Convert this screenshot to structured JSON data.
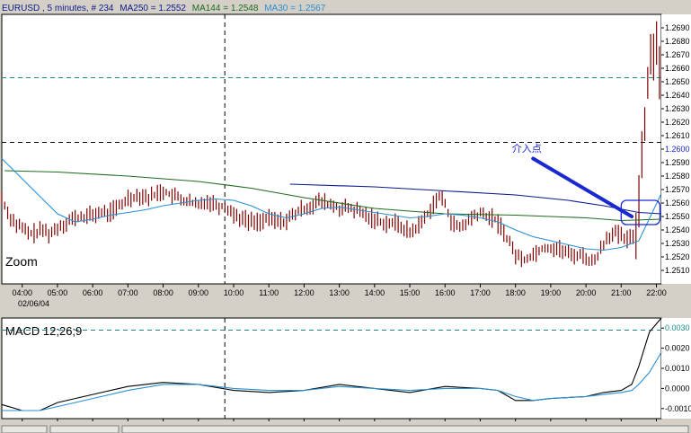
{
  "header": {
    "symbol_text": "EURUSD , 5 minutes, # 234",
    "ma250_text": "MA250 = 1.2552",
    "ma144_text": "MA144 = 1.2548",
    "ma30_text": "MA30 = 1.2567"
  },
  "colors": {
    "background": "#ffffff",
    "frame": "#d4d0c8",
    "price_bar": "#800000",
    "ma250": "#0b1a8a",
    "ma144": "#1e6b1e",
    "ma30": "#2a90d0",
    "macd_line": "#000000",
    "macd_signal": "#2a90d0",
    "arrow": "#1a28d0",
    "highlight_box": "#1a28d0",
    "hline_cyan": "#1a8a8a",
    "hline_dark": "#000000"
  },
  "main_panel": {
    "zoom_label": "Zoom",
    "annotation_text": "介入点",
    "date_label": "02/06/04"
  },
  "macd_panel": {
    "label": "MACD 12;26;9"
  },
  "chart_data": [
    {
      "type": "candlestick",
      "title": "EURUSD , 5 minutes, # 234",
      "x_ticks": [
        "04:00",
        "05:00",
        "06:00",
        "07:00",
        "08:00",
        "09:00",
        "10:00",
        "11:00",
        "12:00",
        "13:00",
        "14:00",
        "15:00",
        "16:00",
        "17:00",
        "18:00",
        "19:00",
        "20:00",
        "21:00",
        "22:00"
      ],
      "x_range": [
        3.42,
        22.14
      ],
      "y_range": [
        1.25,
        1.27
      ],
      "y_ticks": [
        "1.2510",
        "1.2520",
        "1.2530",
        "1.2540",
        "1.2550",
        "1.2560",
        "1.2570",
        "1.2580",
        "1.2590",
        "1.2600",
        "1.2610",
        "1.2620",
        "1.2630",
        "1.2640",
        "1.2650",
        "1.2660",
        "1.2670",
        "1.2680",
        "1.2690"
      ],
      "highlighted_ticks": [
        "1.2600",
        "1.2653"
      ],
      "horizontal_lines": [
        {
          "y": 1.2653,
          "style": "dashed",
          "color": "cyan"
        },
        {
          "y": 1.2605,
          "style": "dashed",
          "color": "black"
        }
      ],
      "vertical_line_x": 9.75,
      "price_path": [
        [
          3.42,
          1.2564
        ],
        [
          3.6,
          1.2552
        ],
        [
          3.8,
          1.2545
        ],
        [
          4.0,
          1.2541
        ],
        [
          4.2,
          1.2537
        ],
        [
          4.4,
          1.2538
        ],
        [
          4.6,
          1.254
        ],
        [
          4.8,
          1.2537
        ],
        [
          5.0,
          1.2542
        ],
        [
          5.2,
          1.2545
        ],
        [
          5.4,
          1.2548
        ],
        [
          5.6,
          1.2549
        ],
        [
          5.8,
          1.255
        ],
        [
          6.0,
          1.2551
        ],
        [
          6.2,
          1.2553
        ],
        [
          6.4,
          1.2552
        ],
        [
          6.6,
          1.2555
        ],
        [
          6.8,
          1.2558
        ],
        [
          7.0,
          1.2564
        ],
        [
          7.2,
          1.2565
        ],
        [
          7.4,
          1.2566
        ],
        [
          7.6,
          1.2564
        ],
        [
          7.8,
          1.2567
        ],
        [
          8.0,
          1.2569
        ],
        [
          8.2,
          1.2566
        ],
        [
          8.4,
          1.2564
        ],
        [
          8.6,
          1.2562
        ],
        [
          8.8,
          1.256
        ],
        [
          9.0,
          1.2558
        ],
        [
          9.2,
          1.2562
        ],
        [
          9.4,
          1.256
        ],
        [
          9.6,
          1.2558
        ],
        [
          9.8,
          1.2557
        ],
        [
          10.0,
          1.2552
        ],
        [
          10.2,
          1.2549
        ],
        [
          10.4,
          1.2547
        ],
        [
          10.6,
          1.2546
        ],
        [
          10.8,
          1.2547
        ],
        [
          11.0,
          1.2548
        ],
        [
          11.2,
          1.2547
        ],
        [
          11.4,
          1.2546
        ],
        [
          11.6,
          1.2549
        ],
        [
          11.8,
          1.2553
        ],
        [
          12.0,
          1.2556
        ],
        [
          12.2,
          1.2558
        ],
        [
          12.4,
          1.2561
        ],
        [
          12.6,
          1.256
        ],
        [
          12.8,
          1.2558
        ],
        [
          13.0,
          1.2556
        ],
        [
          13.2,
          1.2556
        ],
        [
          13.4,
          1.2555
        ],
        [
          13.6,
          1.2553
        ],
        [
          13.8,
          1.255
        ],
        [
          14.0,
          1.2548
        ],
        [
          14.2,
          1.2546
        ],
        [
          14.4,
          1.2545
        ],
        [
          14.6,
          1.2545
        ],
        [
          14.8,
          1.2542
        ],
        [
          15.0,
          1.2538
        ],
        [
          15.2,
          1.2542
        ],
        [
          15.4,
          1.2548
        ],
        [
          15.6,
          1.2556
        ],
        [
          15.8,
          1.2565
        ],
        [
          16.0,
          1.256
        ],
        [
          16.2,
          1.2545
        ],
        [
          16.4,
          1.2541
        ],
        [
          16.6,
          1.2545
        ],
        [
          16.8,
          1.255
        ],
        [
          17.0,
          1.2552
        ],
        [
          17.2,
          1.255
        ],
        [
          17.4,
          1.2548
        ],
        [
          17.6,
          1.2542
        ],
        [
          17.8,
          1.2532
        ],
        [
          18.0,
          1.2522
        ],
        [
          18.2,
          1.2518
        ],
        [
          18.4,
          1.252
        ],
        [
          18.6,
          1.2524
        ],
        [
          18.8,
          1.2527
        ],
        [
          19.0,
          1.2527
        ],
        [
          19.2,
          1.2526
        ],
        [
          19.4,
          1.2524
        ],
        [
          19.6,
          1.2521
        ],
        [
          19.8,
          1.2522
        ],
        [
          20.0,
          1.252
        ],
        [
          20.2,
          1.2515
        ],
        [
          20.4,
          1.2525
        ],
        [
          20.6,
          1.2535
        ],
        [
          20.8,
          1.2538
        ],
        [
          21.0,
          1.2535
        ],
        [
          21.2,
          1.2532
        ],
        [
          21.4,
          1.2538
        ],
        [
          21.5,
          1.256
        ],
        [
          21.6,
          1.2605
        ],
        [
          21.7,
          1.263
        ],
        [
          21.8,
          1.266
        ],
        [
          21.9,
          1.268
        ],
        [
          22.0,
          1.2675
        ],
        [
          22.14,
          1.2658
        ]
      ],
      "series": [
        {
          "name": "MA250",
          "values": [
            [
              11.6,
              1.2574
            ],
            [
              14.0,
              1.2572
            ],
            [
              16.0,
              1.2569
            ],
            [
              18.0,
              1.2566
            ],
            [
              19.5,
              1.2562
            ],
            [
              20.5,
              1.2558
            ],
            [
              21.5,
              1.2553
            ],
            [
              22.14,
              1.2552
            ]
          ]
        },
        {
          "name": "MA144",
          "values": [
            [
              3.5,
              1.2584
            ],
            [
              5.0,
              1.2583
            ],
            [
              7.0,
              1.258
            ],
            [
              9.0,
              1.2576
            ],
            [
              10.5,
              1.2571
            ],
            [
              12.0,
              1.2564
            ],
            [
              14.0,
              1.2556
            ],
            [
              16.0,
              1.2552
            ],
            [
              18.0,
              1.2551
            ],
            [
              20.0,
              1.2549
            ],
            [
              21.0,
              1.2547
            ],
            [
              22.14,
              1.2548
            ]
          ]
        },
        {
          "name": "MA30",
          "values": [
            [
              3.42,
              1.2593
            ],
            [
              4.0,
              1.2578
            ],
            [
              4.5,
              1.2565
            ],
            [
              5.0,
              1.2552
            ],
            [
              5.5,
              1.2546
            ],
            [
              6.0,
              1.2548
            ],
            [
              6.5,
              1.2551
            ],
            [
              7.0,
              1.2553
            ],
            [
              7.5,
              1.2555
            ],
            [
              8.0,
              1.2558
            ],
            [
              8.5,
              1.256
            ],
            [
              9.0,
              1.2562
            ],
            [
              9.5,
              1.2563
            ],
            [
              10.0,
              1.2562
            ],
            [
              10.5,
              1.2558
            ],
            [
              11.0,
              1.2552
            ],
            [
              11.5,
              1.2549
            ],
            [
              12.0,
              1.2552
            ],
            [
              12.5,
              1.2556
            ],
            [
              13.0,
              1.2557
            ],
            [
              13.5,
              1.2555
            ],
            [
              14.0,
              1.2553
            ],
            [
              14.5,
              1.2551
            ],
            [
              15.0,
              1.2549
            ],
            [
              15.5,
              1.255
            ],
            [
              16.0,
              1.2552
            ],
            [
              16.5,
              1.2551
            ],
            [
              17.0,
              1.2549
            ],
            [
              17.5,
              1.2546
            ],
            [
              18.0,
              1.254
            ],
            [
              18.5,
              1.2535
            ],
            [
              19.0,
              1.2532
            ],
            [
              19.5,
              1.2529
            ],
            [
              20.0,
              1.2526
            ],
            [
              20.5,
              1.2525
            ],
            [
              21.0,
              1.2527
            ],
            [
              21.5,
              1.2532
            ],
            [
              22.14,
              1.2567
            ]
          ]
        }
      ],
      "annotation": {
        "label": "介入点",
        "label_at": [
          17.9,
          1.26
        ],
        "arrow_from": [
          18.5,
          1.2593
        ],
        "arrow_to": [
          21.3,
          1.255
        ]
      },
      "highlight_box": {
        "x": [
          21.0,
          22.1
        ],
        "y": [
          1.2544,
          1.2562
        ]
      }
    },
    {
      "type": "line",
      "title": "MACD 12;26;9",
      "x_range": [
        3.42,
        22.14
      ],
      "y_range": [
        -0.0015,
        0.0035
      ],
      "y_ticks": [
        "0.0030",
        "0.0020",
        "0.0010",
        "0.0000",
        "-0.0010"
      ],
      "highlighted_ticks": [
        "0.0030"
      ],
      "horizontal_lines": [
        {
          "y": 0.0029,
          "style": "dashed",
          "color": "cyan"
        }
      ],
      "vertical_line_x": 9.75,
      "series": [
        {
          "name": "MACD",
          "values": [
            [
              3.42,
              -0.0008
            ],
            [
              4.0,
              -0.0011
            ],
            [
              4.5,
              -0.0011
            ],
            [
              5.0,
              -0.0007
            ],
            [
              6.0,
              -0.0003
            ],
            [
              7.0,
              0.0001
            ],
            [
              8.0,
              0.0003
            ],
            [
              9.0,
              0.0002
            ],
            [
              10.0,
              -0.0001
            ],
            [
              11.0,
              -0.0002
            ],
            [
              12.0,
              -0.0001
            ],
            [
              13.0,
              0.0002
            ],
            [
              14.0,
              0.0
            ],
            [
              15.0,
              -0.0002
            ],
            [
              16.0,
              0.0001
            ],
            [
              17.0,
              0.0
            ],
            [
              17.5,
              -0.0001
            ],
            [
              18.0,
              -0.0006
            ],
            [
              18.5,
              -0.0006
            ],
            [
              19.0,
              -0.0005
            ],
            [
              20.0,
              -0.0004
            ],
            [
              20.5,
              -0.0002
            ],
            [
              21.0,
              -0.0001
            ],
            [
              21.3,
              0.0002
            ],
            [
              21.5,
              0.0011
            ],
            [
              21.8,
              0.0028
            ],
            [
              22.14,
              0.0035
            ]
          ]
        },
        {
          "name": "Signal",
          "values": [
            [
              3.42,
              -0.0011
            ],
            [
              4.5,
              -0.0011
            ],
            [
              5.0,
              -0.0009
            ],
            [
              6.0,
              -0.0005
            ],
            [
              7.0,
              -0.0001
            ],
            [
              8.0,
              0.0002
            ],
            [
              9.0,
              0.0002
            ],
            [
              10.0,
              0.0
            ],
            [
              11.0,
              -0.0001
            ],
            [
              12.0,
              -0.0001
            ],
            [
              13.0,
              0.0001
            ],
            [
              14.0,
              0.0
            ],
            [
              15.0,
              -0.0001
            ],
            [
              16.0,
              0.0
            ],
            [
              17.0,
              0.0
            ],
            [
              17.5,
              -0.0001
            ],
            [
              18.0,
              -0.0004
            ],
            [
              18.5,
              -0.0006
            ],
            [
              19.0,
              -0.0005
            ],
            [
              20.0,
              -0.0004
            ],
            [
              20.5,
              -0.0003
            ],
            [
              21.0,
              -0.0002
            ],
            [
              21.3,
              -0.0001
            ],
            [
              21.5,
              0.0002
            ],
            [
              21.8,
              0.0008
            ],
            [
              22.14,
              0.0018
            ]
          ]
        }
      ]
    }
  ]
}
